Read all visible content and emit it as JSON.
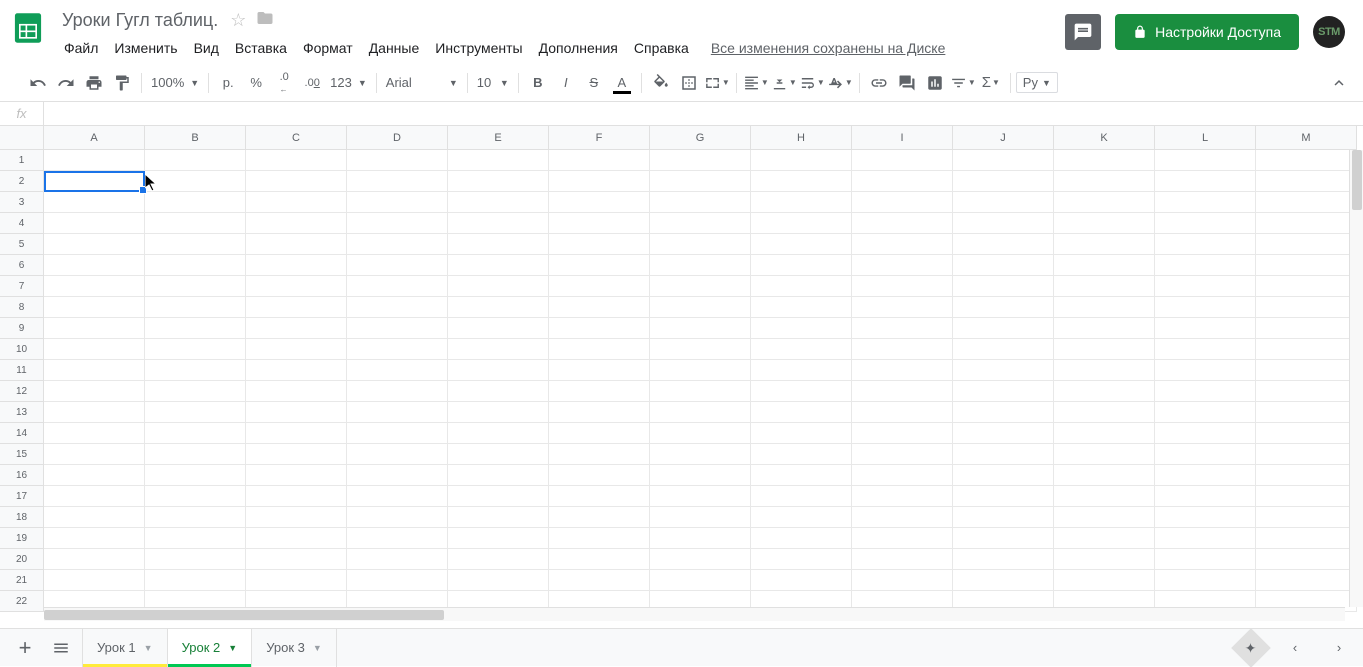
{
  "doc": {
    "title": "Уроки Гугл таблиц."
  },
  "menu": {
    "file": "Файл",
    "edit": "Изменить",
    "view": "Вид",
    "insert": "Вставка",
    "format": "Формат",
    "data": "Данные",
    "tools": "Инструменты",
    "addons": "Дополнения",
    "help": "Справка"
  },
  "save_status": "Все изменения сохранены на Диске",
  "share": {
    "label": "Настройки Доступа"
  },
  "avatar": {
    "initials": "STM"
  },
  "toolbar": {
    "zoom": "100%",
    "currency": "р.",
    "percent": "%",
    "dec_less": ".0",
    "dec_more": ".00",
    "num_format": "123",
    "font": "Arial",
    "font_size": "10",
    "input_method": "Ру"
  },
  "formula": {
    "fx": "fx",
    "value": ""
  },
  "grid": {
    "columns": [
      "A",
      "B",
      "C",
      "D",
      "E",
      "F",
      "G",
      "H",
      "I",
      "J",
      "K",
      "L",
      "M"
    ],
    "rows": [
      "1",
      "2",
      "3",
      "4",
      "5",
      "6",
      "7",
      "8",
      "9",
      "10",
      "11",
      "12",
      "13",
      "14",
      "15",
      "16",
      "17",
      "18",
      "19",
      "20",
      "21",
      "22"
    ],
    "active_cell": "A2"
  },
  "sheets": [
    {
      "name": "Урок 1",
      "active": false,
      "color": "#ffeb3b"
    },
    {
      "name": "Урок 2",
      "active": true,
      "color": "#00c853"
    },
    {
      "name": "Урок 3",
      "active": false,
      "color": ""
    }
  ]
}
